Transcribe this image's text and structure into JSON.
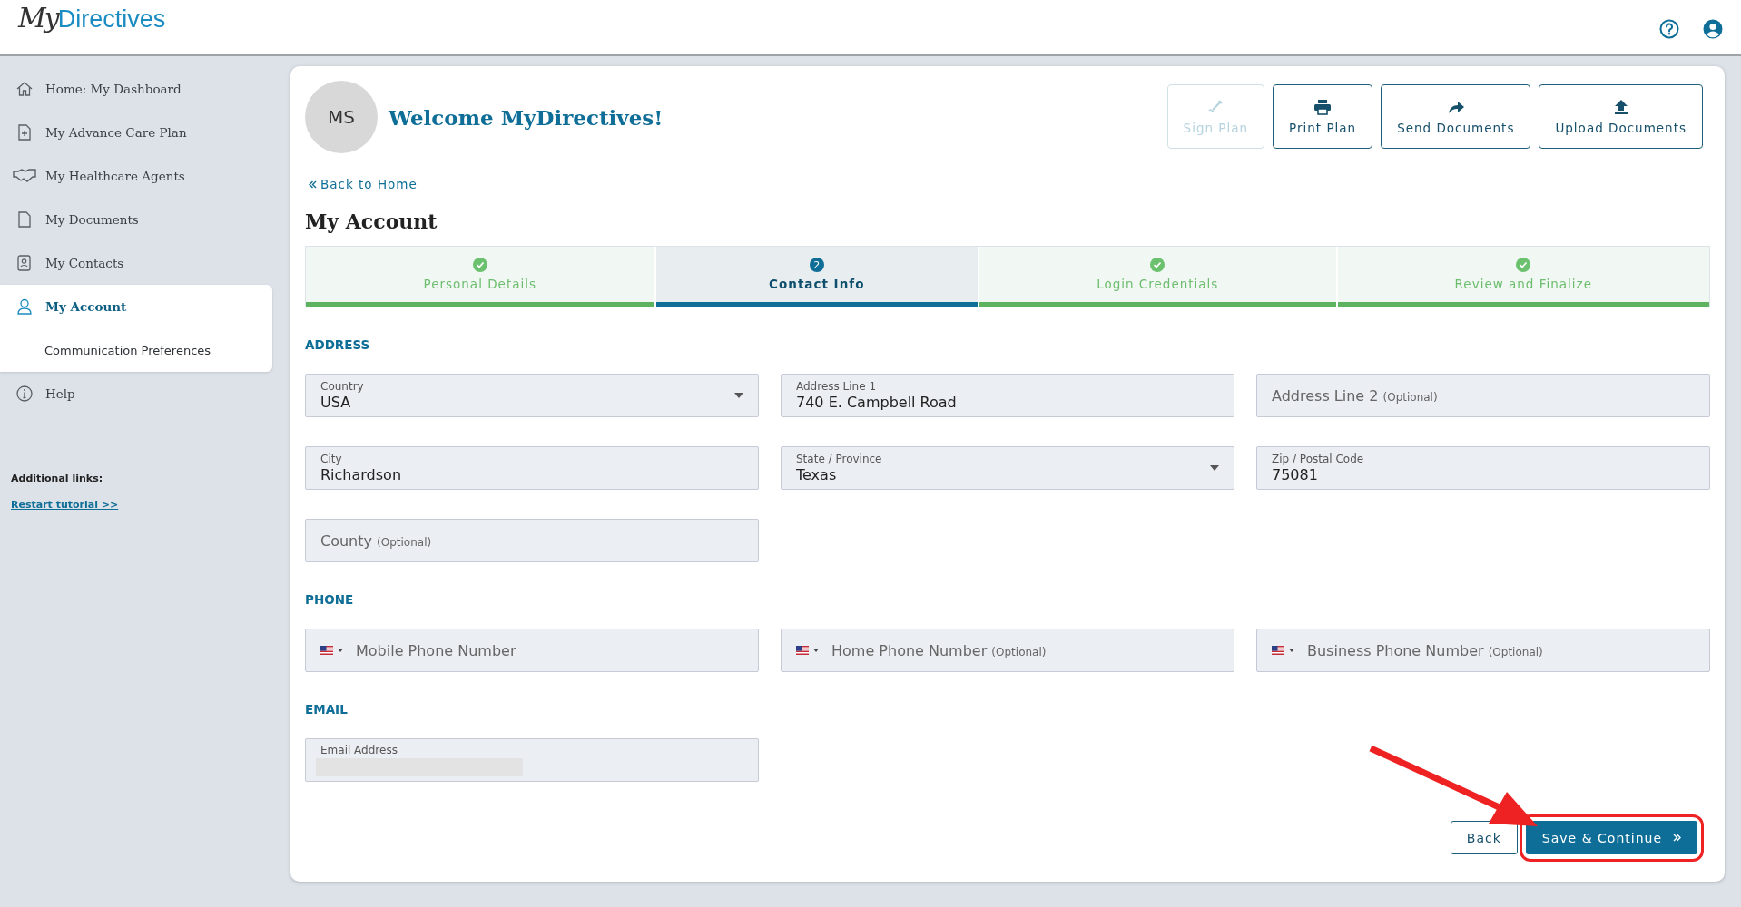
{
  "header": {
    "logo": {
      "script": "My",
      "word": "Directives"
    }
  },
  "sidebar": {
    "items": [
      {
        "label": "Home: My Dashboard",
        "selected": false
      },
      {
        "label": "My Advance Care Plan",
        "selected": false
      },
      {
        "label": "My Healthcare Agents",
        "selected": false
      },
      {
        "label": "My Documents",
        "selected": false
      },
      {
        "label": "My Contacts",
        "selected": false
      },
      {
        "label": "My Account",
        "selected": true,
        "children": [
          {
            "label": "Communication Preferences",
            "selected": false
          }
        ]
      },
      {
        "label": "Help",
        "selected": false
      }
    ],
    "additional_links": {
      "title": "Additional links:",
      "links": [
        "Restart tutorial >>"
      ]
    }
  },
  "profile": {
    "initials": "MS",
    "welcome": "Welcome MyDirectives!"
  },
  "actions": [
    {
      "label": "Sign Plan",
      "disabled": true
    },
    {
      "label": "Print Plan",
      "disabled": false
    },
    {
      "label": "Send Documents",
      "disabled": false
    },
    {
      "label": "Upload Documents",
      "disabled": false
    }
  ],
  "back_link": "Back to Home",
  "page_title": "My Account",
  "steps": [
    {
      "label": "Personal Details",
      "kind": "done",
      "selected": false
    },
    {
      "label": "Contact Info",
      "kind": "current",
      "number": "2",
      "selected": true
    },
    {
      "label": "Login Credentials",
      "kind": "done",
      "selected": false
    },
    {
      "label": "Review and Finalize",
      "kind": "done",
      "selected": false
    }
  ],
  "sections": [
    {
      "title": "ADDRESS",
      "fields": [
        {
          "kind": "select",
          "label": "Country",
          "value": "USA"
        },
        {
          "kind": "text",
          "label": "Address Line 1",
          "value": "740 E. Campbell Road"
        },
        {
          "kind": "text",
          "placeholder": "Address Line 2",
          "note": "(Optional)"
        },
        {
          "kind": "text",
          "label": "City",
          "value": "Richardson"
        },
        {
          "kind": "select",
          "label": "State / Province",
          "value": "Texas"
        },
        {
          "kind": "text",
          "label": "Zip / Postal Code",
          "value": "75081"
        },
        {
          "kind": "text",
          "placeholder": "County",
          "note": "(Optional)"
        }
      ]
    },
    {
      "title": "PHONE",
      "fields": [
        {
          "kind": "phone",
          "placeholder": "Mobile Phone Number"
        },
        {
          "kind": "phone",
          "placeholder": "Home Phone Number",
          "note": "(Optional)"
        },
        {
          "kind": "phone",
          "placeholder": "Business Phone Number",
          "note": "(Optional)"
        }
      ]
    },
    {
      "title": "EMAIL",
      "fields": [
        {
          "kind": "redacted",
          "label": "Email Address"
        }
      ]
    }
  ],
  "buttons": {
    "back": "Back",
    "save": "Save & Continue"
  },
  "annotation": {
    "highlight": true
  }
}
